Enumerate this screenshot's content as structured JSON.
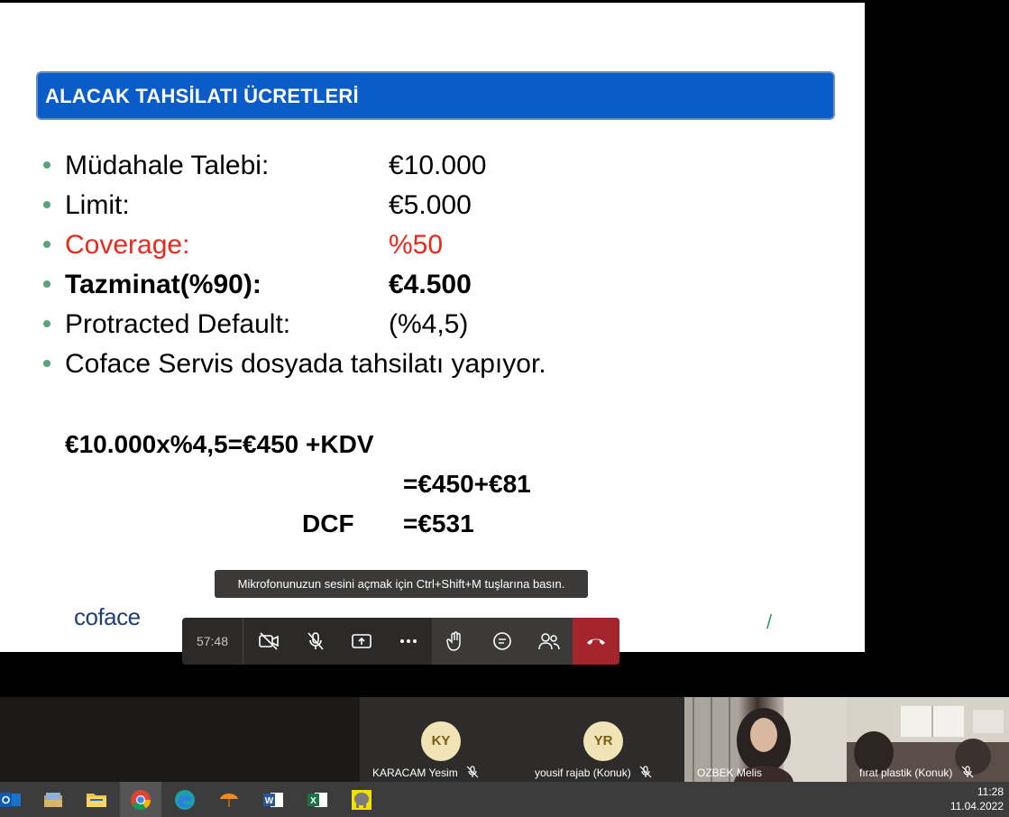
{
  "slide": {
    "title": "ALACAK TAHSİLATI ÜCRETLERİ",
    "bullets": [
      {
        "label": "Müdahale Talebi:",
        "value": "€10.000",
        "style": "normal"
      },
      {
        "label": "Limit:",
        "value": "€5.000",
        "style": "normal"
      },
      {
        "label": "Coverage:",
        "value": "%50",
        "style": "red"
      },
      {
        "label": "Tazminat(%90):",
        "value": "€4.500",
        "style": "bold"
      },
      {
        "label": "Protracted Default:",
        "value": "(%4,5)",
        "style": "normal"
      },
      {
        "label": "Coface Servis dosyada tahsilatı yapıyor.",
        "value": "",
        "style": "normal"
      }
    ],
    "calc_line1": "€10.000x%4,5=€450 +KDV",
    "calc_line2": "=€450+€81",
    "calc_line3_label": "DCF",
    "calc_line3_value": "=€531",
    "logo": "coface",
    "footer_mark": "/",
    "accent_color": "#0a5cc8"
  },
  "tooltip": "Mikrofonunuzun sesini açmak için Ctrl+Shift+M tuşlarına basın.",
  "call_controls": {
    "timer": "57:48",
    "buttons": [
      "video-off-icon",
      "mic-off-icon",
      "share-screen-icon",
      "more-icon",
      "raise-hand-icon",
      "chat-icon",
      "participants-icon",
      "hang-up-icon"
    ]
  },
  "participants": [
    {
      "initials": "KY",
      "name": "KARACAM Yesim",
      "muted": true
    },
    {
      "initials": "YR",
      "name": "yousif rajab (Konuk)",
      "muted": true
    },
    {
      "initials": "",
      "name": "OZBEK Melis",
      "muted": false
    },
    {
      "initials": "",
      "name": "fırat plastik (Konuk)",
      "muted": true
    }
  ],
  "taskbar": {
    "apps": [
      "outlook-icon",
      "file-manager-icon",
      "folder-icon",
      "chrome-icon",
      "edge-icon",
      "umbrella-app-icon",
      "word-icon",
      "excel-icon",
      "elephant-app-icon"
    ],
    "time": "11:28",
    "date": "11.04.2022"
  }
}
